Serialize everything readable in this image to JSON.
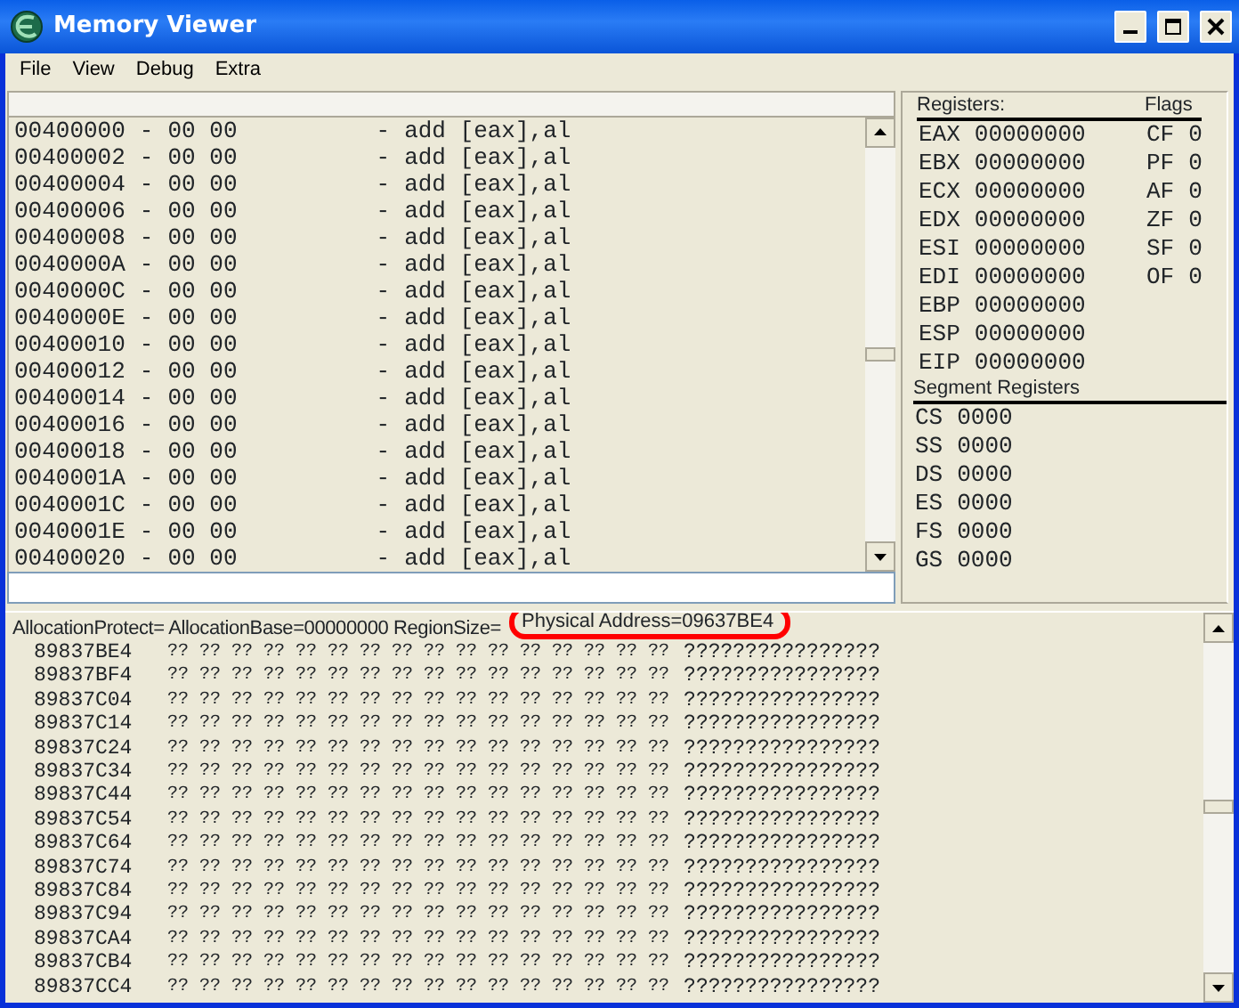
{
  "window": {
    "title": "Memory Viewer"
  },
  "menu": [
    "File",
    "View",
    "Debug",
    "Extra"
  ],
  "disassembly": {
    "rows": [
      {
        "address": "00400000",
        "dash": "-",
        "bytes": "00 00",
        "dash_2": "-",
        "instruction": "add [eax],al"
      },
      {
        "address": "00400002",
        "dash": "-",
        "bytes": "00 00",
        "dash_2": "-",
        "instruction": "add [eax],al"
      },
      {
        "address": "00400004",
        "dash": "-",
        "bytes": "00 00",
        "dash_2": "-",
        "instruction": "add [eax],al"
      },
      {
        "address": "00400006",
        "dash": "-",
        "bytes": "00 00",
        "dash_2": "-",
        "instruction": "add [eax],al"
      },
      {
        "address": "00400008",
        "dash": "-",
        "bytes": "00 00",
        "dash_2": "-",
        "instruction": "add [eax],al"
      },
      {
        "address": "0040000A",
        "dash": "-",
        "bytes": "00 00",
        "dash_2": "-",
        "instruction": "add [eax],al"
      },
      {
        "address": "0040000C",
        "dash": "-",
        "bytes": "00 00",
        "dash_2": "-",
        "instruction": "add [eax],al"
      },
      {
        "address": "0040000E",
        "dash": "-",
        "bytes": "00 00",
        "dash_2": "-",
        "instruction": "add [eax],al"
      },
      {
        "address": "00400010",
        "dash": "-",
        "bytes": "00 00",
        "dash_2": "-",
        "instruction": "add [eax],al"
      },
      {
        "address": "00400012",
        "dash": "-",
        "bytes": "00 00",
        "dash_2": "-",
        "instruction": "add [eax],al"
      },
      {
        "address": "00400014",
        "dash": "-",
        "bytes": "00 00",
        "dash_2": "-",
        "instruction": "add [eax],al"
      },
      {
        "address": "00400016",
        "dash": "-",
        "bytes": "00 00",
        "dash_2": "-",
        "instruction": "add [eax],al"
      },
      {
        "address": "00400018",
        "dash": "-",
        "bytes": "00 00",
        "dash_2": "-",
        "instruction": "add [eax],al"
      },
      {
        "address": "0040001A",
        "dash": "-",
        "bytes": "00 00",
        "dash_2": "-",
        "instruction": "add [eax],al"
      },
      {
        "address": "0040001C",
        "dash": "-",
        "bytes": "00 00",
        "dash_2": "-",
        "instruction": "add [eax],al"
      },
      {
        "address": "0040001E",
        "dash": "-",
        "bytes": "00 00",
        "dash_2": "-",
        "instruction": "add [eax],al"
      },
      {
        "address": "00400020",
        "dash": "-",
        "bytes": "00 00",
        "dash_2": "-",
        "instruction": "add [eax],al"
      }
    ]
  },
  "registers": {
    "title": "Registers:",
    "items": [
      {
        "name": "EAX",
        "value": "00000000"
      },
      {
        "name": "EBX",
        "value": "00000000"
      },
      {
        "name": "ECX",
        "value": "00000000"
      },
      {
        "name": "EDX",
        "value": "00000000"
      },
      {
        "name": "ESI",
        "value": "00000000"
      },
      {
        "name": "EDI",
        "value": "00000000"
      },
      {
        "name": "EBP",
        "value": "00000000"
      },
      {
        "name": "ESP",
        "value": "00000000"
      },
      {
        "name": "EIP",
        "value": "00000000"
      }
    ]
  },
  "flags": {
    "title": "Flags",
    "items": [
      {
        "name": "CF",
        "value": "0"
      },
      {
        "name": "PF",
        "value": "0"
      },
      {
        "name": "AF",
        "value": "0"
      },
      {
        "name": "ZF",
        "value": "0"
      },
      {
        "name": "SF",
        "value": "0"
      },
      {
        "name": "OF",
        "value": "0"
      }
    ]
  },
  "segment_registers": {
    "title": "Segment Registers",
    "items": [
      {
        "name": "CS",
        "value": "0000"
      },
      {
        "name": "SS",
        "value": "0000"
      },
      {
        "name": "DS",
        "value": "0000"
      },
      {
        "name": "ES",
        "value": "0000"
      },
      {
        "name": "FS",
        "value": "0000"
      },
      {
        "name": "GS",
        "value": "0000"
      }
    ]
  },
  "hex_view": {
    "info": "AllocationProtect= AllocationBase=00000000 RegionSize=",
    "annotation": "Physical Address=09637BE4",
    "rows": [
      {
        "address": "89837BE4",
        "bytes": "?? ?? ?? ?? ?? ?? ?? ?? ?? ?? ?? ?? ?? ?? ?? ??",
        "ascii": "????????????????"
      },
      {
        "address": "89837BF4",
        "bytes": "?? ?? ?? ?? ?? ?? ?? ?? ?? ?? ?? ?? ?? ?? ?? ??",
        "ascii": "????????????????"
      },
      {
        "address": "89837C04",
        "bytes": "?? ?? ?? ?? ?? ?? ?? ?? ?? ?? ?? ?? ?? ?? ?? ??",
        "ascii": "????????????????"
      },
      {
        "address": "89837C14",
        "bytes": "?? ?? ?? ?? ?? ?? ?? ?? ?? ?? ?? ?? ?? ?? ?? ??",
        "ascii": "????????????????"
      },
      {
        "address": "89837C24",
        "bytes": "?? ?? ?? ?? ?? ?? ?? ?? ?? ?? ?? ?? ?? ?? ?? ??",
        "ascii": "????????????????"
      },
      {
        "address": "89837C34",
        "bytes": "?? ?? ?? ?? ?? ?? ?? ?? ?? ?? ?? ?? ?? ?? ?? ??",
        "ascii": "????????????????"
      },
      {
        "address": "89837C44",
        "bytes": "?? ?? ?? ?? ?? ?? ?? ?? ?? ?? ?? ?? ?? ?? ?? ??",
        "ascii": "????????????????"
      },
      {
        "address": "89837C54",
        "bytes": "?? ?? ?? ?? ?? ?? ?? ?? ?? ?? ?? ?? ?? ?? ?? ??",
        "ascii": "????????????????"
      },
      {
        "address": "89837C64",
        "bytes": "?? ?? ?? ?? ?? ?? ?? ?? ?? ?? ?? ?? ?? ?? ?? ??",
        "ascii": "????????????????"
      },
      {
        "address": "89837C74",
        "bytes": "?? ?? ?? ?? ?? ?? ?? ?? ?? ?? ?? ?? ?? ?? ?? ??",
        "ascii": "????????????????"
      },
      {
        "address": "89837C84",
        "bytes": "?? ?? ?? ?? ?? ?? ?? ?? ?? ?? ?? ?? ?? ?? ?? ??",
        "ascii": "????????????????"
      },
      {
        "address": "89837C94",
        "bytes": "?? ?? ?? ?? ?? ?? ?? ?? ?? ?? ?? ?? ?? ?? ?? ??",
        "ascii": "????????????????"
      },
      {
        "address": "89837CA4",
        "bytes": "?? ?? ?? ?? ?? ?? ?? ?? ?? ?? ?? ?? ?? ?? ?? ??",
        "ascii": "????????????????"
      },
      {
        "address": "89837CB4",
        "bytes": "?? ?? ?? ?? ?? ?? ?? ?? ?? ?? ?? ?? ?? ?? ?? ??",
        "ascii": "????????????????"
      },
      {
        "address": "89837CC4",
        "bytes": "?? ?? ?? ?? ?? ?? ?? ?? ?? ?? ?? ?? ?? ?? ?? ??",
        "ascii": "????????????????"
      }
    ]
  }
}
